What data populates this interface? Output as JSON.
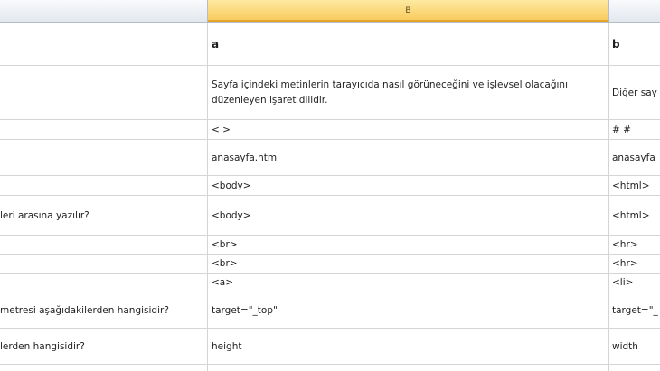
{
  "columns": {
    "a": "",
    "b": "B",
    "c": ""
  },
  "rows": [
    {
      "h": 48,
      "a": "",
      "b": "a",
      "c": "b",
      "bold": true
    },
    {
      "h": 60,
      "a": "",
      "b": "Sayfa içindeki metinlerin tarayıcıda nasıl görüneceğini ve işlevsel olacağını düzenleyen işaret dilidir.",
      "c": "Diğer say",
      "wrap": true
    },
    {
      "h": 22,
      "a": "",
      "b": "< >",
      "c": "# #"
    },
    {
      "h": 40,
      "a": "",
      "b": "anasayfa.htm",
      "c": "anasayfa"
    },
    {
      "h": 22,
      "a": "",
      "b": "<body>",
      "c": "<html>"
    },
    {
      "h": 44,
      "a": "leri arasına yazılır?",
      "b": "<body>",
      "c": "<html>"
    },
    {
      "h": 21,
      "a": "",
      "b": "<br>",
      "c": "<hr>"
    },
    {
      "h": 21,
      "a": "",
      "b": "<br>",
      "c": "<hr>"
    },
    {
      "h": 21,
      "a": "",
      "b": "<a>",
      "c": "<li>"
    },
    {
      "h": 40,
      "a": "metresi aşağıdakilerden hangisidir?",
      "b": "target=\"_top\"",
      "c": "target=\"_"
    },
    {
      "h": 40,
      "a": "lerden hangisidir?",
      "b": "height",
      "c": "width"
    },
    {
      "h": 20,
      "a": "",
      "b": "",
      "c": ""
    }
  ]
}
